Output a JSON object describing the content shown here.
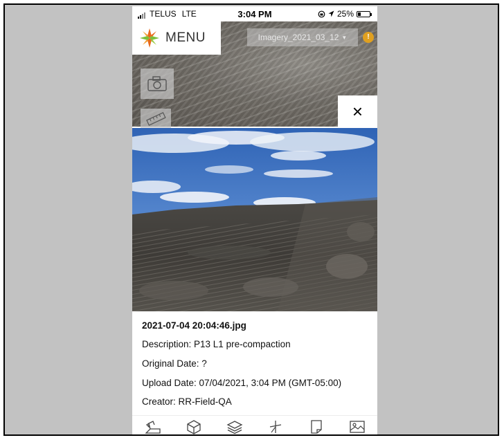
{
  "status_bar": {
    "carrier": "TELUS",
    "network": "LTE",
    "time": "3:04 PM",
    "battery": "25%",
    "battery_level": 0.25,
    "icons": [
      "signal-icon",
      "orientation-lock-icon",
      "location-arrow-icon",
      "battery-icon"
    ]
  },
  "app": {
    "menu_label": "MENU",
    "logo": "compass-star-logo",
    "imagery_select": {
      "value": "Imagery_2021_03_12",
      "icon": "caret-down-icon"
    },
    "alert_badge": "!",
    "map_tools": [
      "camera-icon",
      "ruler-icon"
    ],
    "close_label": "×"
  },
  "photo_details": {
    "filename": "2021-07-04 20:04:46.jpg",
    "description": "Description: P13 L1 pre-compaction",
    "original_date": "Original Date: ?",
    "upload_date": "Upload Date: 07/04/2021, 3:04 PM (GMT-05:00)",
    "creator": "Creator: RR-Field-QA"
  },
  "toolbar": {
    "items": [
      "excavator-icon",
      "cube-icon",
      "layers-icon",
      "survey-point-icon",
      "document-icon",
      "image-icon"
    ]
  },
  "colors": {
    "background": "#c2c2c2",
    "alert": "#e0a020",
    "logo_orange": "#e86a1c",
    "logo_green": "#7bbf3a"
  }
}
